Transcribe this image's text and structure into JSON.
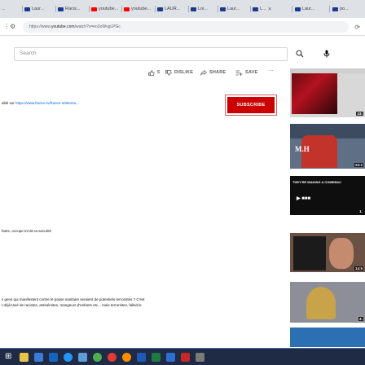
{
  "browser": {
    "tabs": [
      {
        "label": "...",
        "icon": "page-icon"
      },
      {
        "label": "Laur...",
        "icon": "page-icon"
      },
      {
        "label": "Racis...",
        "icon": "page-icon"
      },
      {
        "label": "youtube...",
        "icon": "youtube-icon"
      },
      {
        "label": "youtube...",
        "icon": "youtube-icon"
      },
      {
        "label": "LAUR...",
        "icon": "page-icon"
      },
      {
        "label": "Loi...",
        "icon": "page-icon"
      },
      {
        "label": "Laur...",
        "icon": "page-icon"
      },
      {
        "label": "L...",
        "icon": "page-icon"
      },
      {
        "label": "Laur...",
        "icon": "page-icon"
      },
      {
        "label": "po...",
        "icon": "page-icon"
      }
    ],
    "tab_close_glyph": "✕",
    "url": "https://www.youtube.com/watch?v=eo3oWvgLPGc",
    "url_scheme": "https://www.",
    "url_host": "youtube.com",
    "url_path": "/watch?v=eo3oWvgLPGc"
  },
  "youtube": {
    "search_placeholder": "Search",
    "actions": {
      "like_count": "5",
      "dislike_label": "DISLIKE",
      "share_label": "SHARE",
      "save_label": "SAVE",
      "more_label": "..."
    },
    "subscribe_label": "SUBSCRIBE",
    "description": {
      "line1_prefix": "alité sur ",
      "line1_link": "https://www.france.tv/france-2/telema...",
      "line2": "fants, occupe tol de ta securité",
      "line3": "s gens qui manifestent contre le passe sanitaire seraient de potentiels terroristes ? C'est",
      "line4": "t déjà taxé de racistes, antisémites, mangeurs d'enfants etc... mais terroristes, fallait le"
    },
    "recommended": [
      {
        "thumb": "thumb-1",
        "duration": "23:"
      },
      {
        "thumb": "thumb-2",
        "duration": "23:2",
        "caption": "M.H"
      },
      {
        "thumb": "thumb-3",
        "caption": "THEY'RE MAKING A COMEBAC",
        "logo": "▶ ■■■",
        "duration": "1:"
      },
      {
        "thumb": "thumb-4",
        "duration": "14:5"
      },
      {
        "thumb": "thumb-5",
        "duration": "4:"
      },
      {
        "thumb": "thumb-6"
      }
    ]
  },
  "taskbar": {
    "start_glyph": "⊞",
    "apps": [
      "explorer",
      "store",
      "mail",
      "edge",
      "photos",
      "chrome",
      "opera",
      "firefox",
      "word",
      "excel",
      "onedrive",
      "media",
      "settings"
    ]
  },
  "colors": {
    "subscribe": "#cc0000",
    "link": "#065fd4",
    "tabbar": "#dee1e6",
    "taskbar": "#1f2a44"
  }
}
